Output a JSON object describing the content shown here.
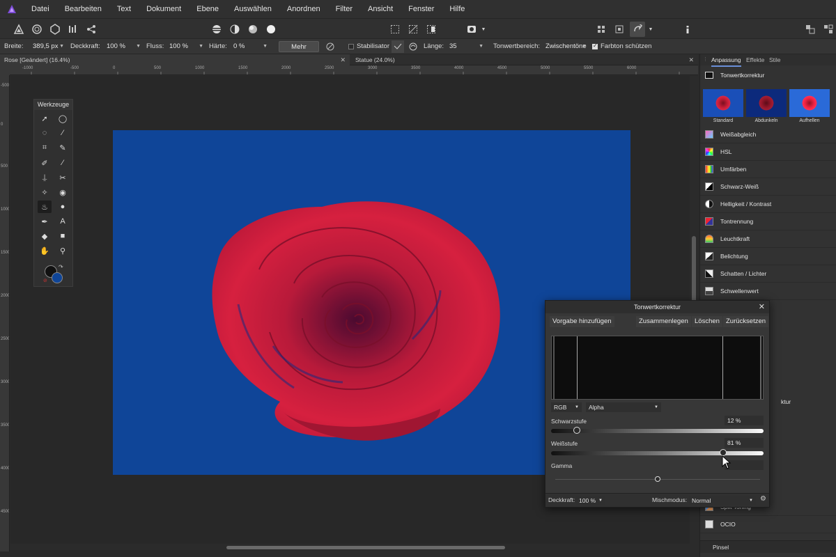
{
  "app": {
    "menu": [
      "Datei",
      "Bearbeiten",
      "Text",
      "Dokument",
      "Ebene",
      "Auswählen",
      "Anordnen",
      "Filter",
      "Ansicht",
      "Fenster",
      "Hilfe"
    ],
    "accent": "#7d4cd8"
  },
  "context": {
    "breite_label": "Breite:",
    "breite_value": "389,5 px",
    "deckkraft_label": "Deckkraft:",
    "deckkraft_value": "100 %",
    "fluss_label": "Fluss:",
    "fluss_value": "100 %",
    "haerte_label": "Härte:",
    "haerte_value": "0 %",
    "mehr": "Mehr",
    "stabilisator": "Stabilisator",
    "laenge_label": "Länge:",
    "laenge_value": "35",
    "tonwert_label": "Tonwertbereich:",
    "tonwert_value": "Zwischentöne",
    "farbton": "Farbton schützen"
  },
  "tabs": [
    {
      "title": "Rose [Geändert] (16.4%)"
    },
    {
      "title": "Statue (24.0%)"
    }
  ],
  "rulers": {
    "top": [
      "-1000",
      "-500",
      "0",
      "500",
      "1000",
      "1500",
      "2000",
      "2500",
      "3000",
      "3500",
      "4000",
      "4500",
      "5000",
      "5500",
      "6000"
    ],
    "left": [
      "-500",
      "0",
      "500",
      "1000",
      "1500",
      "2000",
      "2500",
      "3000",
      "3500",
      "4000",
      "4500"
    ]
  },
  "document": {
    "background": "#0f4598"
  },
  "tools_panel": {
    "title": "Werkzeuge"
  },
  "right_panel": {
    "tabs": [
      "Anpassung",
      "Effekte",
      "Stile"
    ],
    "header": "Tonwertkorrektur",
    "presets": [
      "Standard",
      "Abdunkeln",
      "Aufhellen"
    ],
    "items": [
      "Weißabgleich",
      "HSL",
      "Umfärben",
      "Schwarz-Weiß",
      "Helligkeit / Kontrast",
      "Tontrennung",
      "Leuchtkraft",
      "Belichtung",
      "Schatten / Lichter",
      "Schwellenwert"
    ],
    "partial_item": "ktur",
    "bottom_items": [
      "Split Toning",
      "OCIO"
    ],
    "footer": "Pinsel"
  },
  "dialog": {
    "title": "Tonwertkorrektur",
    "buttons": [
      "Vorgabe hinzufügen",
      "Zusammenlegen",
      "Löschen",
      "Zurücksetzen"
    ],
    "channel": "RGB",
    "mode": "Alpha",
    "schwarz_label": "Schwarzstufe",
    "schwarz_value": "12 %",
    "schwarz_level": 0.12,
    "weiss_label": "Weißstufe",
    "weiss_value": "81 %",
    "weiss_level": 0.81,
    "gamma_label": "Gamma",
    "gamma_level": 0.5,
    "deckkraft_label": "Deckkraft:",
    "deckkraft_value": "100 %",
    "misch_label": "Mischmodus:",
    "misch_value": "Normal"
  }
}
